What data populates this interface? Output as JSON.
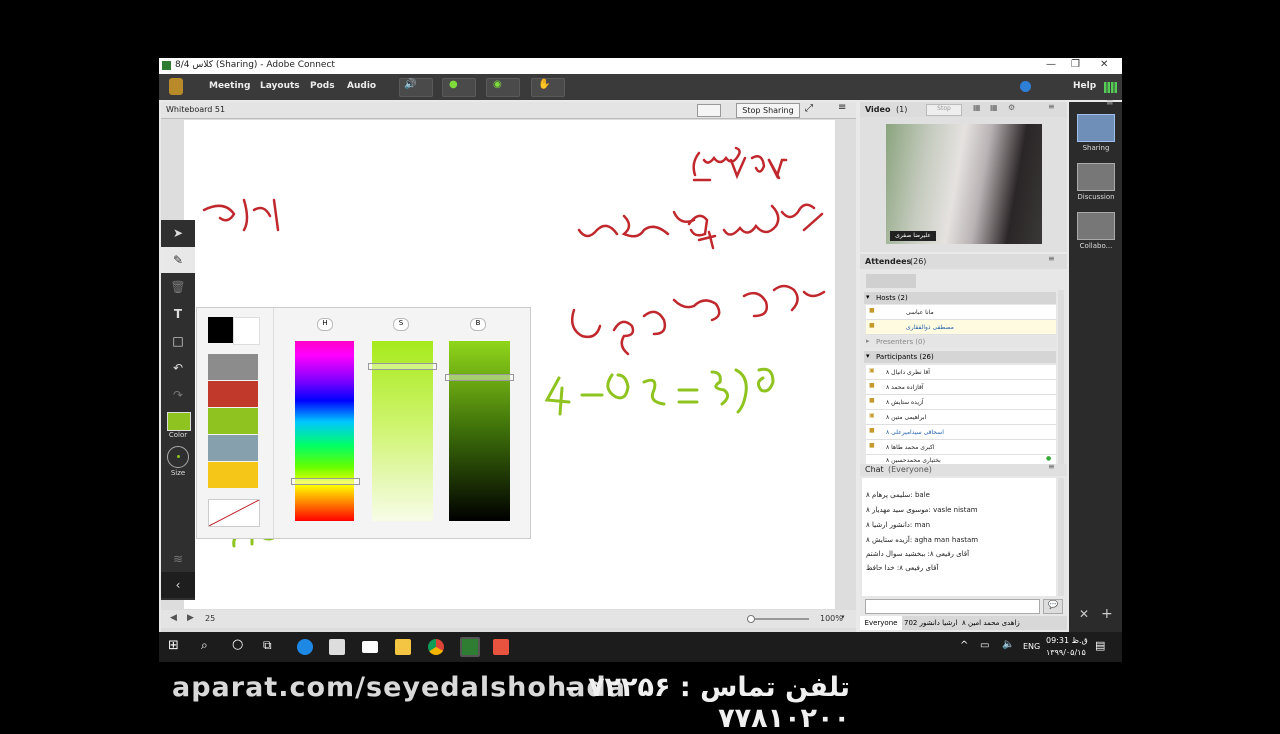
{
  "window": {
    "title": "کلاس 8/4 (Sharing) - Adobe Connect",
    "controls": [
      "—",
      "❐",
      "✕"
    ]
  },
  "menu": {
    "items": [
      "Meeting",
      "Layouts",
      "Pods",
      "Audio"
    ],
    "help": "Help"
  },
  "whiteboard": {
    "title": "Whiteboard 51",
    "stop_sharing": "Stop Sharing",
    "page": "25",
    "zoom": "100%",
    "tools": {
      "color_label": "Color",
      "size_label": "Size",
      "text_tool": "T"
    },
    "picker": {
      "h": "H",
      "s": "S",
      "b": "B"
    },
    "handwriting": [
      "۶۸ –",
      "۱۷ بلی کی",
      "ب) کسری ساوی ۶۵ بیاکنند به اختلاف",
      "صورت و مخرج",
      "۴ – ۶۵ = ۳۹",
      "۳۹ ۱۴۵",
      "اختلاف"
    ],
    "pen_color": "#8fc31f",
    "ink_color": "#c0282d"
  },
  "video": {
    "title": "Video",
    "count": "(1)",
    "stop_label": "Stop",
    "name_tag": "علیرضا صفری"
  },
  "attendees": {
    "title": "Attendees",
    "count": "(26)",
    "hosts_label": "Hosts (2)",
    "hosts": [
      "مانا عباسی",
      "مصطفی ذوالفقاری"
    ],
    "presenters_label": "Presenters (0)",
    "participants_label": "Participants (26)",
    "participants": [
      "آقا نظری دانیال ۸",
      "آقازاده محمد ۸",
      "آزیده ستایش ۸",
      "ابراهیمی متین ۸",
      "اسحاقی سیدامیرعلی ۸",
      "اکبری محمد طاها ۸",
      "بختیاری محمدحسین ۸"
    ]
  },
  "chat": {
    "title": "Chat",
    "scope": "(Everyone)",
    "messages": [
      {
        "from": "سلیمی پرهام ۸",
        "text": "bale"
      },
      {
        "from": "موسوی سید مهدیار ۸",
        "text": "vasle nistam"
      },
      {
        "from": "دانشور ارشیا ۸",
        "text": "man"
      },
      {
        "from": "آزیده ستایش ۸",
        "text": "agha man hastam"
      },
      {
        "from": "آقای رفیعی ۸",
        "text": "ببخشید سوال داشتم"
      },
      {
        "from": "آقای رفیعی ۸",
        "text": "خدا حافظ"
      }
    ],
    "tabs": [
      "Everyone",
      "702 ارشیا دانشور",
      "زاهدی محمد امین ۸"
    ]
  },
  "layouts": [
    "Sharing",
    "Discussion",
    "Collabo..."
  ],
  "taskbar": {
    "lang": "ENG",
    "time": "09:31 ق.ظ",
    "date": "۱۳۹۹/۰۵/۱۵"
  },
  "overlay": {
    "url": "aparat.com/seyedalshohada",
    "phone": "تلفن تماس : ۷۲۲۵۶ – ۷۷۸۱۰۲۰۰"
  },
  "colors": {
    "swatches": [
      "#000000",
      "#ffffff",
      "#8c8c8c",
      "#c0392b",
      "#8fc31f",
      "#86a0ad",
      "#f5c518"
    ]
  }
}
